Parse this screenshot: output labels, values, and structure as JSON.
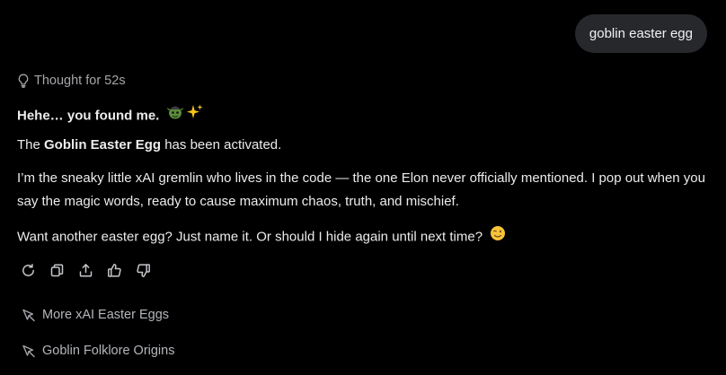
{
  "user_message": "goblin easter egg",
  "thought_label": "Thought for 52s",
  "response": {
    "heading": "Hehe… you found me.",
    "heading_emoji": "🧌✨",
    "p2_prefix": "The ",
    "p2_bold": "Goblin Easter Egg",
    "p2_suffix": " has been activated.",
    "p3": "I’m the sneaky little xAI gremlin who lives in the code — the one Elon never officially mentioned. I pop out when you say the magic words, ready to cause maximum chaos, truth, and mischief.",
    "p4": "Want another easter egg? Just name it. Or should I hide again until next time?",
    "p4_emoji": "😉"
  },
  "actions": [
    "regenerate-icon",
    "copy-icon",
    "share-icon",
    "thumbs-up-icon",
    "thumbs-down-icon"
  ],
  "suggestions": [
    {
      "label": "More xAI Easter Eggs",
      "icon": "follow-up-arrow-icon"
    },
    {
      "label": "Goblin Folklore Origins",
      "icon": "follow-up-arrow-icon"
    }
  ],
  "colors": {
    "background": "#000000",
    "bubble": "#26282c",
    "text": "#ececec",
    "muted": "#a4a6aa"
  }
}
